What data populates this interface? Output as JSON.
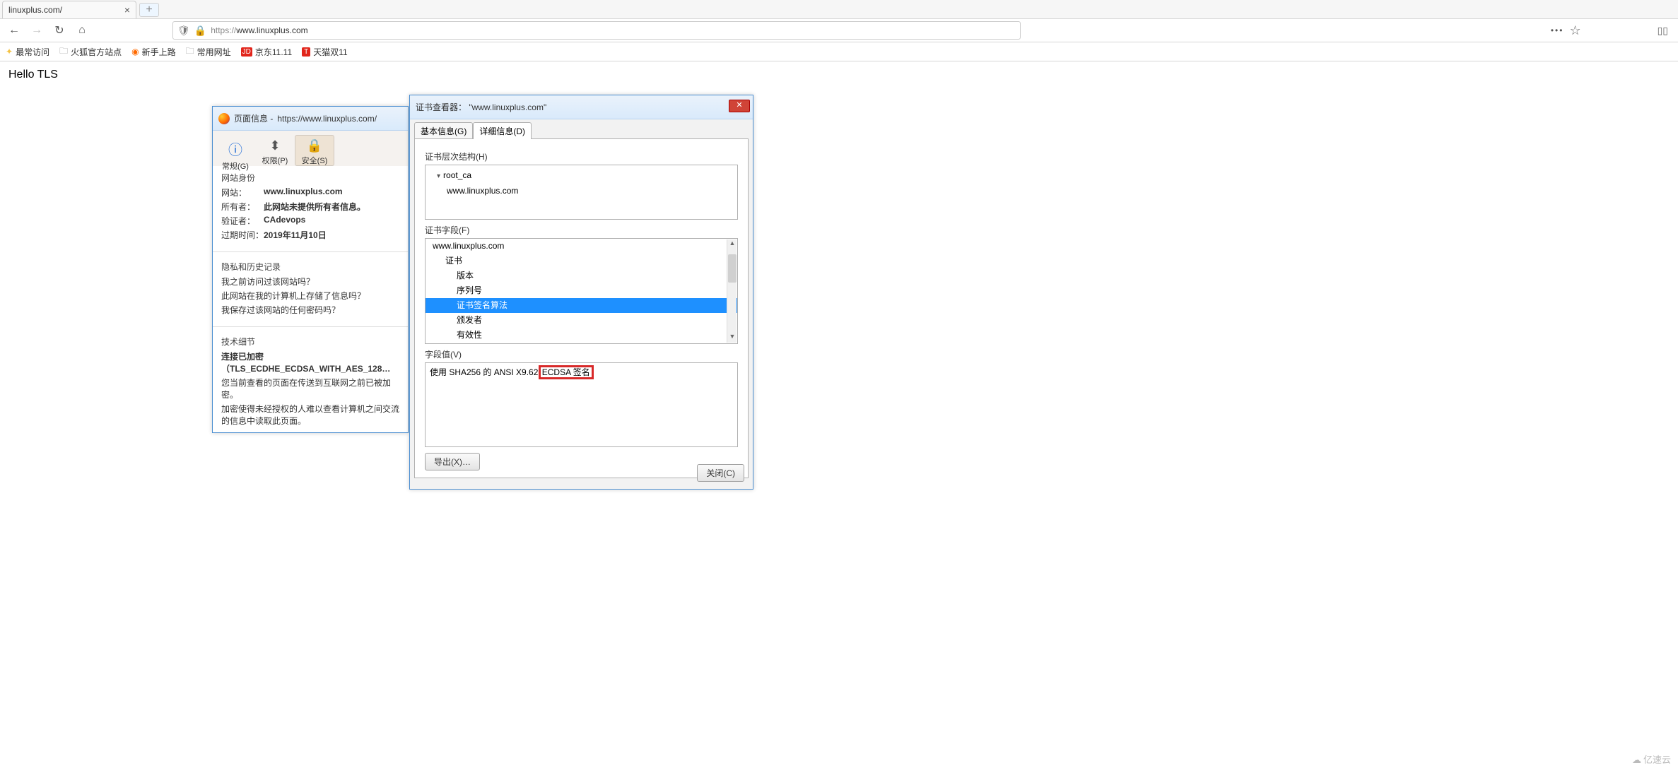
{
  "tab": {
    "title": "linuxplus.com/"
  },
  "url": {
    "protocol": "https://",
    "host": "www.linuxplus.com"
  },
  "bookmarks": {
    "most_visited": "最常访问",
    "firefox_sites": "火狐官方站点",
    "getting_started": "新手上路",
    "common_urls": "常用网址",
    "jd": "京东11.11",
    "tmall": "天猫双11"
  },
  "page": {
    "body": "Hello TLS"
  },
  "pageinfo": {
    "title_prefix": "页面信息 -",
    "title_url": "https://www.linuxplus.com/",
    "tabs": {
      "general": "常规(G)",
      "perms": "权限(P)",
      "security": "安全(S)"
    },
    "identity": {
      "header": "网站身份",
      "site_k": "网站：",
      "site_v": "www.linuxplus.com",
      "owner_k": "所有者：",
      "owner_v": "此网站未提供所有者信息。",
      "verifier_k": "验证者：",
      "verifier_v": "CAdevops",
      "expiry_k": "过期时间：",
      "expiry_v": "2019年11月10日"
    },
    "history": {
      "header": "隐私和历史记录",
      "q1": "我之前访问过该网站吗？",
      "q2": "此网站在我的计算机上存储了信息吗？",
      "q3": "我保存过该网站的任何密码吗？"
    },
    "tech": {
      "header": "技术细节",
      "cipher": "连接已加密（TLS_ECDHE_ECDSA_WITH_AES_128…",
      "line1": "您当前查看的页面在传送到互联网之前已被加密。",
      "line2": "加密使得未经授权的人难以查看计算机之间交流的信息中读取此页面。"
    }
  },
  "certviewer": {
    "title": "证书查看器： \"www.linuxplus.com\"",
    "tabs": {
      "basic": "基本信息(G)",
      "details": "详细信息(D)"
    },
    "hierarchy_label": "证书层次结构(H)",
    "hier_root": "root_ca",
    "hier_leaf": "www.linuxplus.com",
    "fields_label": "证书字段(F)",
    "fields": {
      "site": "www.linuxplus.com",
      "cert": "证书",
      "version": "版本",
      "serial": "序列号",
      "sigalg": "证书签名算法",
      "issuer": "颁发者",
      "validity": "有效性"
    },
    "value_label": "字段值(V)",
    "value_pre": "使用 SHA256 的 ANSI X9.62 ",
    "value_hi": "ECDSA 签名",
    "export": "导出(X)…",
    "close": "关闭(C)"
  },
  "watermark": "亿速云"
}
